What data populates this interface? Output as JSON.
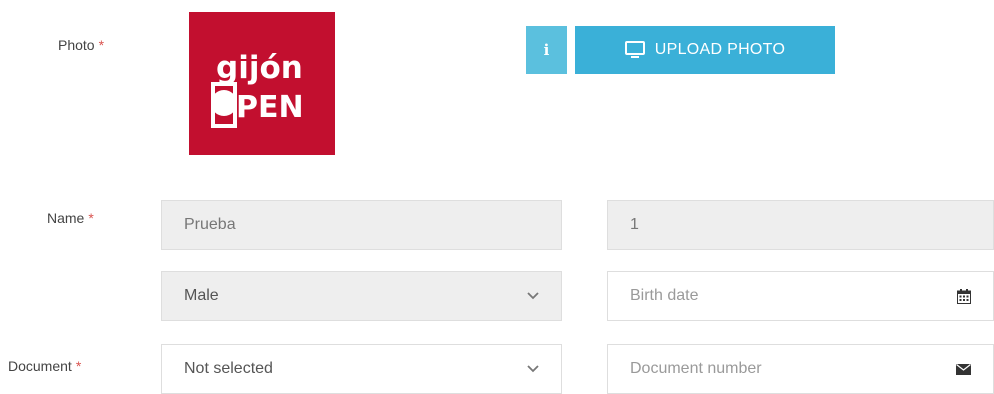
{
  "form": {
    "photo": {
      "label": "Photo",
      "required_mark": "*",
      "logo_text_top": "gijón",
      "logo_text_bottom": "PEN",
      "info_label": "i",
      "upload_label": "UPLOAD PHOTO"
    },
    "name": {
      "label": "Name",
      "required_mark": "*",
      "first_value": "Prueba",
      "second_value": "1"
    },
    "gender": {
      "value": "Male"
    },
    "birth_date": {
      "placeholder": "Birth date"
    },
    "document": {
      "label": "Document",
      "required_mark": "*",
      "type_value": "Not selected",
      "number_placeholder": "Document number"
    }
  },
  "colors": {
    "required": "#d9534f",
    "logo_background": "#c20f2f",
    "info_button": "#5bc0de",
    "upload_button": "#3ab0d8",
    "disabled_field": "#eeeeee"
  },
  "icons": {
    "upload": "monitor-icon",
    "info": "info-icon",
    "select": "chevron-down-icon",
    "birth_date": "calendar-icon",
    "document_number": "envelope-icon"
  }
}
